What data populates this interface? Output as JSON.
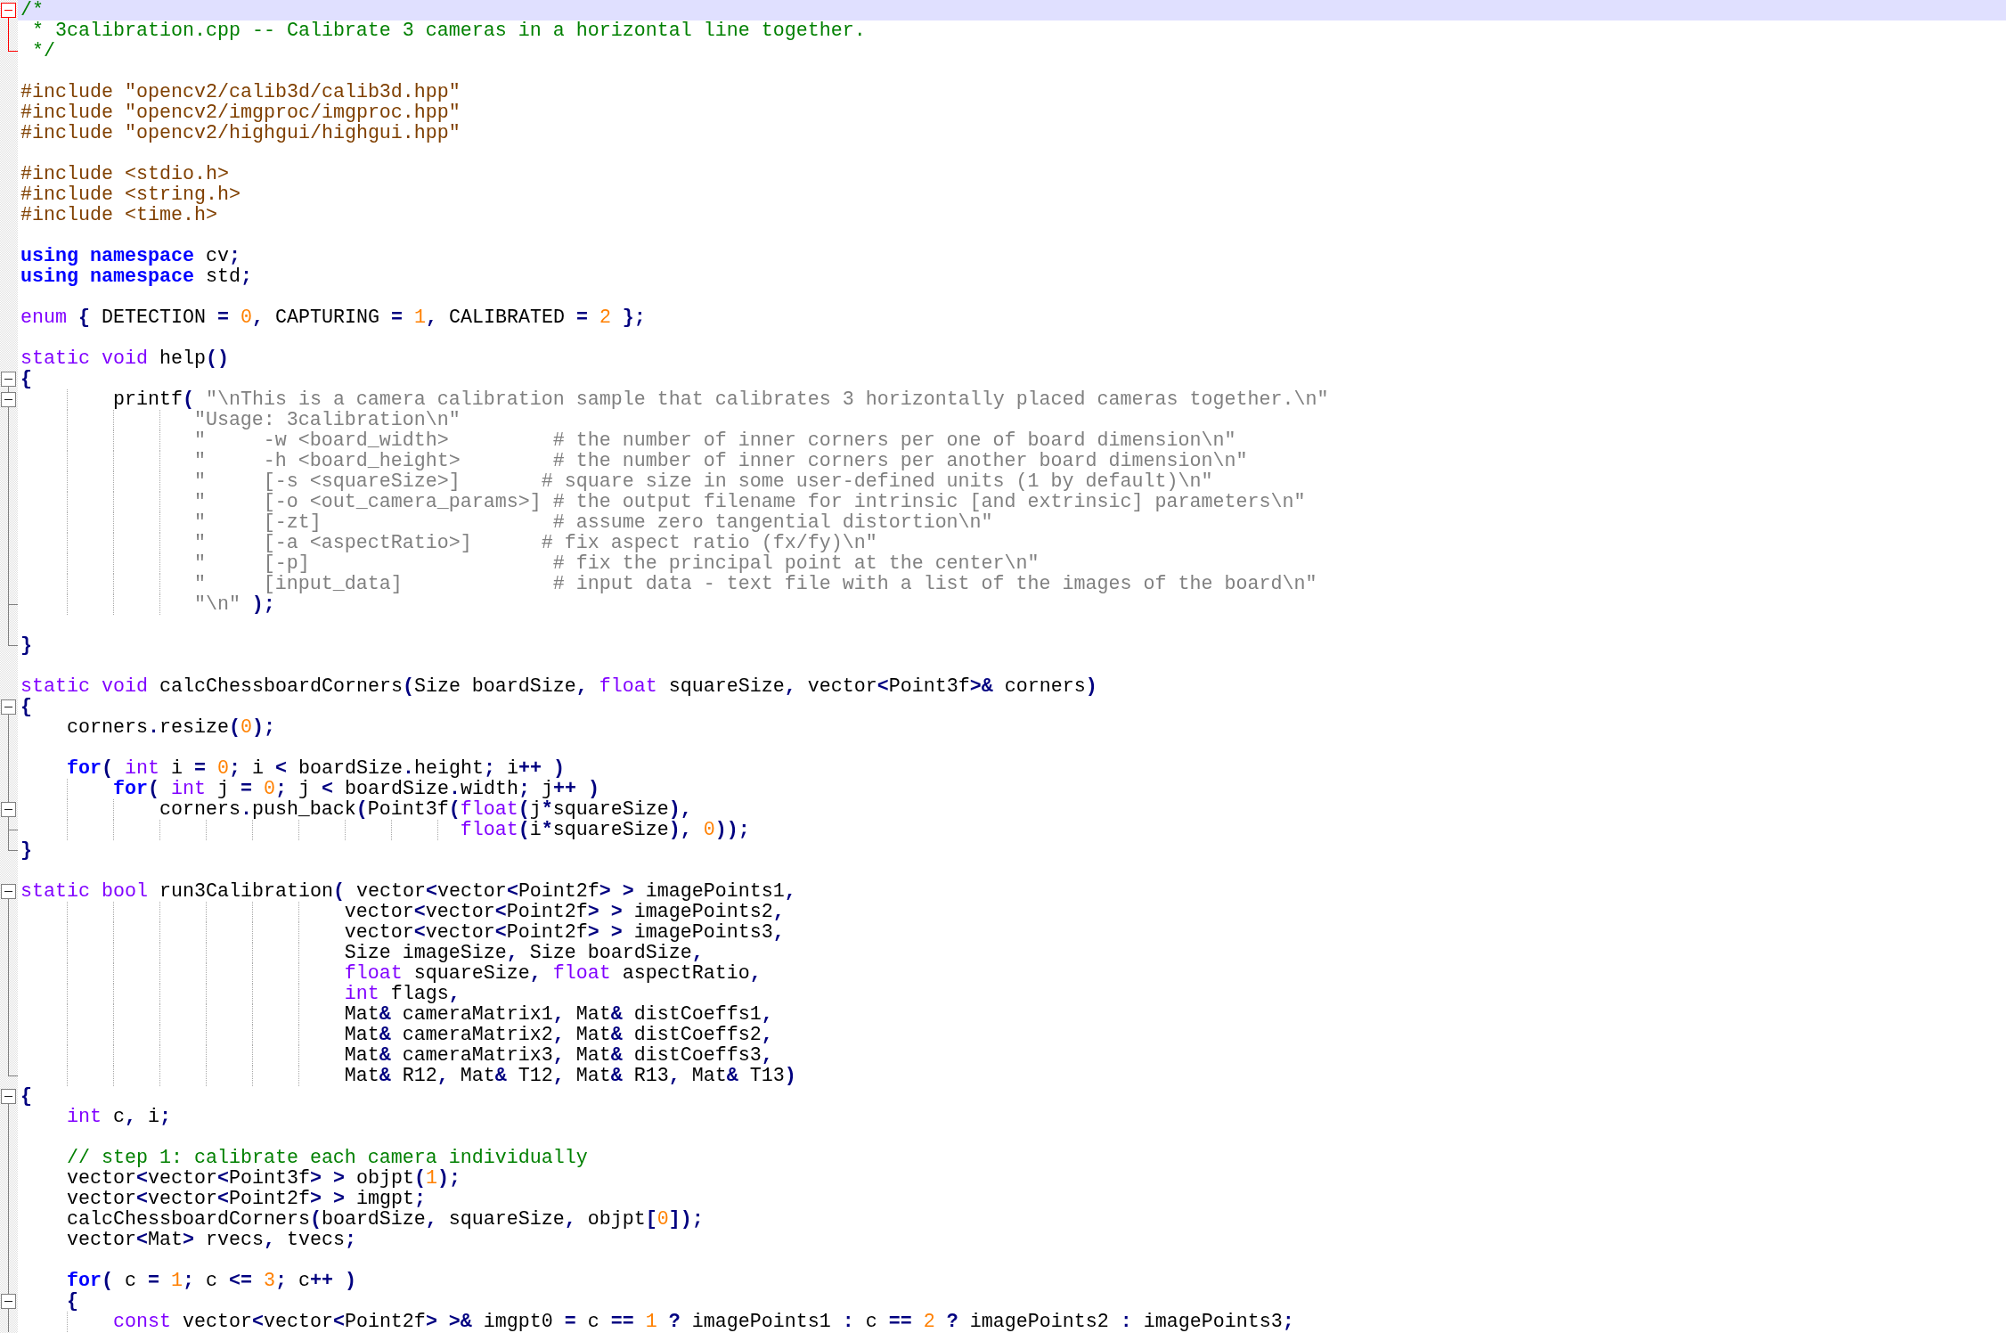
{
  "editor": {
    "lines": [
      {
        "current": true,
        "kind": "foldstart",
        "tokens": [
          {
            "kind": "comment",
            "text": "/*"
          }
        ]
      },
      {
        "current": false,
        "kind": "text",
        "tokens": [
          {
            "kind": "comment",
            "text": " * 3calibration.cpp -- Calibrate 3 cameras in a horizontal line together."
          }
        ]
      },
      {
        "current": false,
        "kind": "foldend",
        "tokens": [
          {
            "kind": "comment",
            "text": " */"
          }
        ]
      },
      {
        "current": false,
        "kind": "blank"
      },
      {
        "current": false,
        "kind": "text",
        "tokens": [
          {
            "kind": "directive",
            "text": "#include \"opencv2/calib3d/calib3d.hpp\""
          }
        ]
      },
      {
        "current": false,
        "kind": "text",
        "tokens": [
          {
            "kind": "directive",
            "text": "#include \"opencv2/imgproc/imgproc.hpp\""
          }
        ]
      },
      {
        "current": false,
        "kind": "text",
        "tokens": [
          {
            "kind": "directive",
            "text": "#include \"opencv2/highgui/highgui.hpp\""
          }
        ]
      },
      {
        "current": false,
        "kind": "blank"
      },
      {
        "current": false,
        "kind": "text",
        "tokens": [
          {
            "kind": "directive",
            "text": "#include <stdio.h>"
          }
        ]
      },
      {
        "current": false,
        "kind": "text",
        "tokens": [
          {
            "kind": "directive",
            "text": "#include <string.h>"
          }
        ]
      },
      {
        "current": false,
        "kind": "text",
        "tokens": [
          {
            "kind": "directive",
            "text": "#include <time.h>"
          }
        ]
      },
      {
        "current": false,
        "kind": "blank"
      },
      {
        "current": false,
        "kind": "text",
        "tokens": [
          {
            "kind": "keyword",
            "text": "using namespace"
          },
          {
            "kind": "plain",
            "text": " cv"
          },
          {
            "kind": "op",
            "text": ";"
          }
        ]
      },
      {
        "current": false,
        "kind": "text",
        "tokens": [
          {
            "kind": "keyword",
            "text": "using namespace"
          },
          {
            "kind": "plain",
            "text": " std"
          },
          {
            "kind": "op",
            "text": ";"
          }
        ]
      },
      {
        "current": false,
        "kind": "blank"
      },
      {
        "current": false,
        "kind": "text",
        "tokens": [
          {
            "kind": "type",
            "text": "enum"
          },
          {
            "kind": "op",
            "text": " {"
          },
          {
            "kind": "plain",
            "text": " DETECTION "
          },
          {
            "kind": "op",
            "text": "= "
          },
          {
            "kind": "number",
            "text": "0"
          },
          {
            "kind": "op",
            "text": ","
          },
          {
            "kind": "plain",
            "text": " CAPTURING "
          },
          {
            "kind": "op",
            "text": "= "
          },
          {
            "kind": "number",
            "text": "1"
          },
          {
            "kind": "op",
            "text": ","
          },
          {
            "kind": "plain",
            "text": " CALIBRATED "
          },
          {
            "kind": "op",
            "text": "= "
          },
          {
            "kind": "number",
            "text": "2"
          },
          {
            "kind": "op",
            "text": " };"
          }
        ]
      },
      {
        "current": false,
        "kind": "blank"
      },
      {
        "current": false,
        "kind": "text",
        "tokens": [
          {
            "kind": "type",
            "text": "static void"
          },
          {
            "kind": "plain",
            "text": " help"
          },
          {
            "kind": "op",
            "text": "()"
          }
        ]
      },
      {
        "current": false,
        "kind": "foldstart",
        "tokens": [
          {
            "kind": "op",
            "text": "{"
          }
        ]
      },
      {
        "current": false,
        "kind": "foldstart",
        "tokens": [
          {
            "kind": "plain",
            "text": "\t\tprintf"
          },
          {
            "kind": "op",
            "text": "( "
          },
          {
            "kind": "string",
            "text": "\"\\nThis is a camera calibration sample that calibrates 3 horizontally placed cameras together.\\n\""
          }
        ]
      },
      {
        "current": false,
        "kind": "text",
        "tokens": [
          {
            "kind": "string",
            "text": "\t\t\t   \"Usage: 3calibration\\n\""
          }
        ]
      },
      {
        "current": false,
        "kind": "text",
        "tokens": [
          {
            "kind": "string",
            "text": "\t\t\t   \"     -w <board_width>         # the number of inner corners per one of board dimension\\n\""
          }
        ]
      },
      {
        "current": false,
        "kind": "text",
        "tokens": [
          {
            "kind": "string",
            "text": "\t\t\t   \"     -h <board_height>        # the number of inner corners per another board dimension\\n\""
          }
        ]
      },
      {
        "current": false,
        "kind": "text",
        "tokens": [
          {
            "kind": "string",
            "text": "\t\t\t   \"     [-s <squareSize>]       # square size in some user-defined units (1 by default)\\n\""
          }
        ]
      },
      {
        "current": false,
        "kind": "text",
        "tokens": [
          {
            "kind": "string",
            "text": "\t\t\t   \"     [-o <out_camera_params>] # the output filename for intrinsic [and extrinsic] parameters\\n\""
          }
        ]
      },
      {
        "current": false,
        "kind": "text",
        "tokens": [
          {
            "kind": "string",
            "text": "\t\t\t   \"     [-zt]                    # assume zero tangential distortion\\n\""
          }
        ]
      },
      {
        "current": false,
        "kind": "text",
        "tokens": [
          {
            "kind": "string",
            "text": "\t\t\t   \"     [-a <aspectRatio>]      # fix aspect ratio (fx/fy)\\n\""
          }
        ]
      },
      {
        "current": false,
        "kind": "text",
        "tokens": [
          {
            "kind": "string",
            "text": "\t\t\t   \"     [-p]                     # fix the principal point at the center\\n\""
          }
        ]
      },
      {
        "current": false,
        "kind": "text",
        "tokens": [
          {
            "kind": "string",
            "text": "\t\t\t   \"     [input_data]             # input data - text file with a list of the images of the board\\n\""
          }
        ]
      },
      {
        "current": false,
        "kind": "foldend",
        "tokens": [
          {
            "kind": "string",
            "text": "\t\t\t   \"\\n\""
          },
          {
            "kind": "op",
            "text": " );"
          }
        ]
      },
      {
        "current": false,
        "kind": "blank"
      },
      {
        "current": false,
        "kind": "foldend",
        "tokens": [
          {
            "kind": "op",
            "text": "}"
          }
        ]
      },
      {
        "current": false,
        "kind": "blank"
      },
      {
        "current": false,
        "kind": "text",
        "tokens": [
          {
            "kind": "type",
            "text": "static void"
          },
          {
            "kind": "plain",
            "text": " calcChessboardCorners"
          },
          {
            "kind": "op",
            "text": "("
          },
          {
            "kind": "plain",
            "text": "Size boardSize"
          },
          {
            "kind": "op",
            "text": ", "
          },
          {
            "kind": "type",
            "text": "float"
          },
          {
            "kind": "plain",
            "text": " squareSize"
          },
          {
            "kind": "op",
            "text": ", "
          },
          {
            "kind": "plain",
            "text": "vector"
          },
          {
            "kind": "op",
            "text": "<"
          },
          {
            "kind": "plain",
            "text": "Point3f"
          },
          {
            "kind": "op",
            "text": ">&"
          },
          {
            "kind": "plain",
            "text": " corners"
          },
          {
            "kind": "op",
            "text": ")"
          }
        ]
      },
      {
        "current": false,
        "kind": "foldstart",
        "tokens": [
          {
            "kind": "op",
            "text": "{"
          }
        ]
      },
      {
        "current": false,
        "kind": "text",
        "tokens": [
          {
            "kind": "plain",
            "text": "\tcorners"
          },
          {
            "kind": "op",
            "text": "."
          },
          {
            "kind": "plain",
            "text": "resize"
          },
          {
            "kind": "op",
            "text": "("
          },
          {
            "kind": "number",
            "text": "0"
          },
          {
            "kind": "op",
            "text": ");"
          }
        ]
      },
      {
        "current": false,
        "kind": "blank"
      },
      {
        "current": false,
        "kind": "text",
        "tokens": [
          {
            "kind": "keyword",
            "text": "\tfor"
          },
          {
            "kind": "op",
            "text": "( "
          },
          {
            "kind": "type",
            "text": "int"
          },
          {
            "kind": "plain",
            "text": " i "
          },
          {
            "kind": "op",
            "text": "= "
          },
          {
            "kind": "number",
            "text": "0"
          },
          {
            "kind": "op",
            "text": "; "
          },
          {
            "kind": "plain",
            "text": "i "
          },
          {
            "kind": "op",
            "text": "<"
          },
          {
            "kind": "plain",
            "text": " boardSize"
          },
          {
            "kind": "op",
            "text": "."
          },
          {
            "kind": "plain",
            "text": "height"
          },
          {
            "kind": "op",
            "text": "; "
          },
          {
            "kind": "plain",
            "text": "i"
          },
          {
            "kind": "op",
            "text": "++ )"
          }
        ]
      },
      {
        "current": false,
        "kind": "text",
        "tokens": [
          {
            "kind": "keyword",
            "text": "\t\tfor"
          },
          {
            "kind": "op",
            "text": "( "
          },
          {
            "kind": "type",
            "text": "int"
          },
          {
            "kind": "plain",
            "text": " j "
          },
          {
            "kind": "op",
            "text": "= "
          },
          {
            "kind": "number",
            "text": "0"
          },
          {
            "kind": "op",
            "text": "; "
          },
          {
            "kind": "plain",
            "text": "j "
          },
          {
            "kind": "op",
            "text": "<"
          },
          {
            "kind": "plain",
            "text": " boardSize"
          },
          {
            "kind": "op",
            "text": "."
          },
          {
            "kind": "plain",
            "text": "width"
          },
          {
            "kind": "op",
            "text": "; "
          },
          {
            "kind": "plain",
            "text": "j"
          },
          {
            "kind": "op",
            "text": "++ )"
          }
        ]
      },
      {
        "current": false,
        "kind": "foldstart",
        "tokens": [
          {
            "kind": "plain",
            "text": "\t\t\tcorners"
          },
          {
            "kind": "op",
            "text": "."
          },
          {
            "kind": "plain",
            "text": "push_back"
          },
          {
            "kind": "op",
            "text": "("
          },
          {
            "kind": "plain",
            "text": "Point3f"
          },
          {
            "kind": "op",
            "text": "("
          },
          {
            "kind": "type",
            "text": "float"
          },
          {
            "kind": "op",
            "text": "("
          },
          {
            "kind": "plain",
            "text": "j"
          },
          {
            "kind": "op",
            "text": "*"
          },
          {
            "kind": "plain",
            "text": "squareSize"
          },
          {
            "kind": "op",
            "text": "),"
          }
        ]
      },
      {
        "current": false,
        "kind": "foldend",
        "tokens": [
          {
            "kind": "type",
            "text": "\t\t\t\t\t\t\t\t\t  float"
          },
          {
            "kind": "op",
            "text": "("
          },
          {
            "kind": "plain",
            "text": "i"
          },
          {
            "kind": "op",
            "text": "*"
          },
          {
            "kind": "plain",
            "text": "squareSize"
          },
          {
            "kind": "op",
            "text": "), "
          },
          {
            "kind": "number",
            "text": "0"
          },
          {
            "kind": "op",
            "text": "));"
          }
        ]
      },
      {
        "current": false,
        "kind": "foldend",
        "tokens": [
          {
            "kind": "op",
            "text": "}"
          }
        ]
      },
      {
        "current": false,
        "kind": "blank"
      },
      {
        "current": false,
        "kind": "foldstart",
        "tokens": [
          {
            "kind": "type",
            "text": "static bool"
          },
          {
            "kind": "plain",
            "text": " run3Calibration"
          },
          {
            "kind": "op",
            "text": "( "
          },
          {
            "kind": "plain",
            "text": "vector"
          },
          {
            "kind": "op",
            "text": "<"
          },
          {
            "kind": "plain",
            "text": "vector"
          },
          {
            "kind": "op",
            "text": "<"
          },
          {
            "kind": "plain",
            "text": "Point2f"
          },
          {
            "kind": "op",
            "text": "> >"
          },
          {
            "kind": "plain",
            "text": " imagePoints1"
          },
          {
            "kind": "op",
            "text": ","
          }
        ]
      },
      {
        "current": false,
        "kind": "text",
        "tokens": [
          {
            "kind": "plain",
            "text": "\t\t\t\t\t\t\tvector"
          },
          {
            "kind": "op",
            "text": "<"
          },
          {
            "kind": "plain",
            "text": "vector"
          },
          {
            "kind": "op",
            "text": "<"
          },
          {
            "kind": "plain",
            "text": "Point2f"
          },
          {
            "kind": "op",
            "text": "> >"
          },
          {
            "kind": "plain",
            "text": " imagePoints2"
          },
          {
            "kind": "op",
            "text": ","
          }
        ]
      },
      {
        "current": false,
        "kind": "text",
        "tokens": [
          {
            "kind": "plain",
            "text": "\t\t\t\t\t\t\tvector"
          },
          {
            "kind": "op",
            "text": "<"
          },
          {
            "kind": "plain",
            "text": "vector"
          },
          {
            "kind": "op",
            "text": "<"
          },
          {
            "kind": "plain",
            "text": "Point2f"
          },
          {
            "kind": "op",
            "text": "> >"
          },
          {
            "kind": "plain",
            "text": " imagePoints3"
          },
          {
            "kind": "op",
            "text": ","
          }
        ]
      },
      {
        "current": false,
        "kind": "text",
        "tokens": [
          {
            "kind": "plain",
            "text": "\t\t\t\t\t\t\tSize imageSize"
          },
          {
            "kind": "op",
            "text": ", "
          },
          {
            "kind": "plain",
            "text": "Size boardSize"
          },
          {
            "kind": "op",
            "text": ","
          }
        ]
      },
      {
        "current": false,
        "kind": "text",
        "tokens": [
          {
            "kind": "type",
            "text": "\t\t\t\t\t\t\tfloat"
          },
          {
            "kind": "plain",
            "text": " squareSize"
          },
          {
            "kind": "op",
            "text": ", "
          },
          {
            "kind": "type",
            "text": "float"
          },
          {
            "kind": "plain",
            "text": " aspectRatio"
          },
          {
            "kind": "op",
            "text": ","
          }
        ]
      },
      {
        "current": false,
        "kind": "text",
        "tokens": [
          {
            "kind": "type",
            "text": "\t\t\t\t\t\t\tint"
          },
          {
            "kind": "plain",
            "text": " flags"
          },
          {
            "kind": "op",
            "text": ","
          }
        ]
      },
      {
        "current": false,
        "kind": "text",
        "tokens": [
          {
            "kind": "plain",
            "text": "\t\t\t\t\t\t\tMat"
          },
          {
            "kind": "op",
            "text": "&"
          },
          {
            "kind": "plain",
            "text": " cameraMatrix1"
          },
          {
            "kind": "op",
            "text": ", "
          },
          {
            "kind": "plain",
            "text": "Mat"
          },
          {
            "kind": "op",
            "text": "&"
          },
          {
            "kind": "plain",
            "text": " distCoeffs1"
          },
          {
            "kind": "op",
            "text": ","
          }
        ]
      },
      {
        "current": false,
        "kind": "text",
        "tokens": [
          {
            "kind": "plain",
            "text": "\t\t\t\t\t\t\tMat"
          },
          {
            "kind": "op",
            "text": "&"
          },
          {
            "kind": "plain",
            "text": " cameraMatrix2"
          },
          {
            "kind": "op",
            "text": ", "
          },
          {
            "kind": "plain",
            "text": "Mat"
          },
          {
            "kind": "op",
            "text": "&"
          },
          {
            "kind": "plain",
            "text": " distCoeffs2"
          },
          {
            "kind": "op",
            "text": ","
          }
        ]
      },
      {
        "current": false,
        "kind": "text",
        "tokens": [
          {
            "kind": "plain",
            "text": "\t\t\t\t\t\t\tMat"
          },
          {
            "kind": "op",
            "text": "&"
          },
          {
            "kind": "plain",
            "text": " cameraMatrix3"
          },
          {
            "kind": "op",
            "text": ", "
          },
          {
            "kind": "plain",
            "text": "Mat"
          },
          {
            "kind": "op",
            "text": "&"
          },
          {
            "kind": "plain",
            "text": " distCoeffs3"
          },
          {
            "kind": "op",
            "text": ","
          }
        ]
      },
      {
        "current": false,
        "kind": "foldend",
        "tokens": [
          {
            "kind": "plain",
            "text": "\t\t\t\t\t\t\tMat"
          },
          {
            "kind": "op",
            "text": "&"
          },
          {
            "kind": "plain",
            "text": " R12"
          },
          {
            "kind": "op",
            "text": ", "
          },
          {
            "kind": "plain",
            "text": "Mat"
          },
          {
            "kind": "op",
            "text": "&"
          },
          {
            "kind": "plain",
            "text": " T12"
          },
          {
            "kind": "op",
            "text": ", "
          },
          {
            "kind": "plain",
            "text": "Mat"
          },
          {
            "kind": "op",
            "text": "&"
          },
          {
            "kind": "plain",
            "text": " R13"
          },
          {
            "kind": "op",
            "text": ", "
          },
          {
            "kind": "plain",
            "text": "Mat"
          },
          {
            "kind": "op",
            "text": "&"
          },
          {
            "kind": "plain",
            "text": " T13"
          },
          {
            "kind": "op",
            "text": ")"
          }
        ]
      },
      {
        "current": false,
        "kind": "foldstart",
        "tokens": [
          {
            "kind": "op",
            "text": "{"
          }
        ]
      },
      {
        "current": false,
        "kind": "text",
        "tokens": [
          {
            "kind": "type",
            "text": "\tint"
          },
          {
            "kind": "plain",
            "text": " c"
          },
          {
            "kind": "op",
            "text": ", "
          },
          {
            "kind": "plain",
            "text": "i"
          },
          {
            "kind": "op",
            "text": ";"
          }
        ]
      },
      {
        "current": false,
        "kind": "blank"
      },
      {
        "current": false,
        "kind": "text",
        "tokens": [
          {
            "kind": "comment",
            "text": "\t// step 1: calibrate each camera individually"
          }
        ]
      },
      {
        "current": false,
        "kind": "text",
        "tokens": [
          {
            "kind": "plain",
            "text": "\tvector"
          },
          {
            "kind": "op",
            "text": "<"
          },
          {
            "kind": "plain",
            "text": "vector"
          },
          {
            "kind": "op",
            "text": "<"
          },
          {
            "kind": "plain",
            "text": "Point3f"
          },
          {
            "kind": "op",
            "text": "> >"
          },
          {
            "kind": "plain",
            "text": " objpt"
          },
          {
            "kind": "op",
            "text": "("
          },
          {
            "kind": "number",
            "text": "1"
          },
          {
            "kind": "op",
            "text": ");"
          }
        ]
      },
      {
        "current": false,
        "kind": "text",
        "tokens": [
          {
            "kind": "plain",
            "text": "\tvector"
          },
          {
            "kind": "op",
            "text": "<"
          },
          {
            "kind": "plain",
            "text": "vector"
          },
          {
            "kind": "op",
            "text": "<"
          },
          {
            "kind": "plain",
            "text": "Point2f"
          },
          {
            "kind": "op",
            "text": "> >"
          },
          {
            "kind": "plain",
            "text": " imgpt"
          },
          {
            "kind": "op",
            "text": ";"
          }
        ]
      },
      {
        "current": false,
        "kind": "text",
        "tokens": [
          {
            "kind": "plain",
            "text": "\tcalcChessboardCorners"
          },
          {
            "kind": "op",
            "text": "("
          },
          {
            "kind": "plain",
            "text": "boardSize"
          },
          {
            "kind": "op",
            "text": ", "
          },
          {
            "kind": "plain",
            "text": "squareSize"
          },
          {
            "kind": "op",
            "text": ", "
          },
          {
            "kind": "plain",
            "text": "objpt"
          },
          {
            "kind": "op",
            "text": "["
          },
          {
            "kind": "number",
            "text": "0"
          },
          {
            "kind": "op",
            "text": "]);"
          }
        ]
      },
      {
        "current": false,
        "kind": "text",
        "tokens": [
          {
            "kind": "plain",
            "text": "\tvector"
          },
          {
            "kind": "op",
            "text": "<"
          },
          {
            "kind": "plain",
            "text": "Mat"
          },
          {
            "kind": "op",
            "text": ">"
          },
          {
            "kind": "plain",
            "text": " rvecs"
          },
          {
            "kind": "op",
            "text": ", "
          },
          {
            "kind": "plain",
            "text": "tvecs"
          },
          {
            "kind": "op",
            "text": ";"
          }
        ]
      },
      {
        "current": false,
        "kind": "blank"
      },
      {
        "current": false,
        "kind": "text",
        "tokens": [
          {
            "kind": "keyword",
            "text": "\tfor"
          },
          {
            "kind": "op",
            "text": "( "
          },
          {
            "kind": "plain",
            "text": "c "
          },
          {
            "kind": "op",
            "text": "= "
          },
          {
            "kind": "number",
            "text": "1"
          },
          {
            "kind": "op",
            "text": "; "
          },
          {
            "kind": "plain",
            "text": "c "
          },
          {
            "kind": "op",
            "text": "<= "
          },
          {
            "kind": "number",
            "text": "3"
          },
          {
            "kind": "op",
            "text": "; "
          },
          {
            "kind": "plain",
            "text": "c"
          },
          {
            "kind": "op",
            "text": "++ )"
          }
        ]
      },
      {
        "current": false,
        "kind": "foldstart",
        "tokens": [
          {
            "kind": "op",
            "text": "\t{"
          }
        ]
      },
      {
        "current": false,
        "kind": "text",
        "tokens": [
          {
            "kind": "type",
            "text": "\t\tconst"
          },
          {
            "kind": "plain",
            "text": " vector"
          },
          {
            "kind": "op",
            "text": "<"
          },
          {
            "kind": "plain",
            "text": "vector"
          },
          {
            "kind": "op",
            "text": "<"
          },
          {
            "kind": "plain",
            "text": "Point2f"
          },
          {
            "kind": "op",
            "text": "> >&"
          },
          {
            "kind": "plain",
            "text": " imgpt0 "
          },
          {
            "kind": "op",
            "text": "="
          },
          {
            "kind": "plain",
            "text": " c "
          },
          {
            "kind": "op",
            "text": "== "
          },
          {
            "kind": "number",
            "text": "1"
          },
          {
            "kind": "op",
            "text": " ?"
          },
          {
            "kind": "plain",
            "text": " imagePoints1 "
          },
          {
            "kind": "op",
            "text": ":"
          },
          {
            "kind": "plain",
            "text": " c "
          },
          {
            "kind": "op",
            "text": "== "
          },
          {
            "kind": "number",
            "text": "2"
          },
          {
            "kind": "op",
            "text": " ?"
          },
          {
            "kind": "plain",
            "text": " imagePoints2 "
          },
          {
            "kind": "op",
            "text": ":"
          },
          {
            "kind": "plain",
            "text": " imagePoints3"
          },
          {
            "kind": "op",
            "text": ";"
          }
        ]
      }
    ]
  }
}
